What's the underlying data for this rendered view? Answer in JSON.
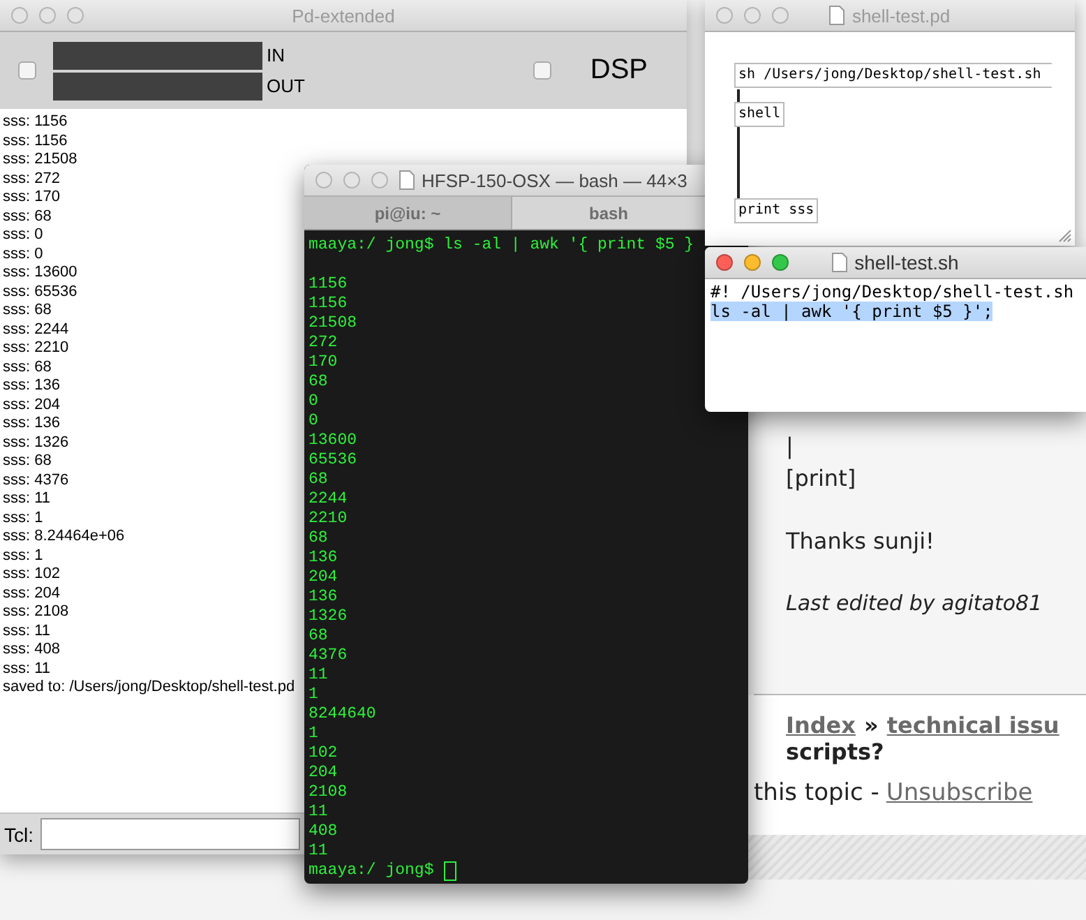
{
  "forum_page": {
    "post_lines": [
      "|",
      "[print]"
    ],
    "thanks": "Thanks sunji!",
    "edited": "Last edited by agitato81",
    "breadcrumb": [
      {
        "kind": "link",
        "text": "Index"
      },
      {
        "kind": "text",
        "text": "»"
      },
      {
        "kind": "link",
        "text": "technical issu"
      }
    ],
    "topic_end": "scripts?",
    "subscribe_text": "this topic -",
    "unsubscribe": "Unsubscribe"
  },
  "pd_window": {
    "title": "Pd-extended",
    "meter_labels": [
      "IN",
      "OUT"
    ],
    "input_toggle": {
      "checked": false
    },
    "dsp": {
      "label": "DSP",
      "checked": false
    },
    "console": [
      "sss: 1156",
      "sss: 1156",
      "sss: 21508",
      "sss: 272",
      "sss: 170",
      "sss: 68",
      "sss: 0",
      "sss: 0",
      "sss: 13600",
      "sss: 65536",
      "sss: 68",
      "sss: 2244",
      "sss: 2210",
      "sss: 68",
      "sss: 136",
      "sss: 204",
      "sss: 136",
      "sss: 1326",
      "sss: 68",
      "sss: 4376",
      "sss: 11",
      "sss: 1",
      "sss: 8.24464e+06",
      "sss: 1",
      "sss: 102",
      "sss: 204",
      "sss: 2108",
      "sss: 11",
      "sss: 408",
      "sss: 11",
      "saved to: /Users/jong/Desktop/shell-test.pd"
    ],
    "tcl_label": "Tcl:"
  },
  "terminal": {
    "title": "HFSP-150-OSX — bash — 44×3",
    "tabs": [
      {
        "label": "pi@iu: ~",
        "selected": false
      },
      {
        "label": "bash",
        "selected": true
      }
    ],
    "command": "maaya:/ jong$ ls -al | awk '{ print $5 }",
    "output": [
      "1156",
      "1156",
      "21508",
      "272",
      "170",
      "68",
      "0",
      "0",
      "13600",
      "65536",
      "68",
      "2244",
      "2210",
      "68",
      "136",
      "204",
      "136",
      "1326",
      "68",
      "4376",
      "11",
      "1",
      "8244640",
      "1",
      "102",
      "204",
      "2108",
      "11",
      "408",
      "11"
    ],
    "prompt": "maaya:/ jong$"
  },
  "patch_window": {
    "title": "shell-test.pd",
    "boxes": [
      {
        "kind": "message",
        "text": "sh /Users/jong/Desktop/shell-test.sh"
      },
      {
        "kind": "object",
        "text": "shell"
      },
      {
        "kind": "object",
        "text": "print sss"
      }
    ]
  },
  "editor": {
    "title": "shell-test.sh",
    "lines": [
      {
        "text": "#! /Users/jong/Desktop/shell-test.sh",
        "selected": false
      },
      {
        "text": "ls -al | awk '{ print $5 }';",
        "selected": true
      }
    ]
  }
}
